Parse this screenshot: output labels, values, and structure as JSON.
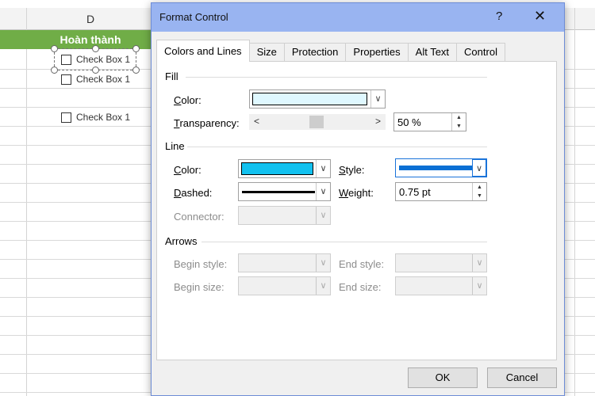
{
  "sheet": {
    "column_header": "D",
    "completed_header": "Hoàn thành",
    "checkboxes": [
      "Check Box 1",
      "Check Box 1",
      "Check Box 1"
    ]
  },
  "dialog": {
    "title": "Format Control",
    "help": "?",
    "close": "✕",
    "tabs": [
      "Colors and Lines",
      "Size",
      "Protection",
      "Properties",
      "Alt Text",
      "Control"
    ],
    "active_tab": "Colors and Lines",
    "fill": {
      "group": "Fill",
      "color_label": "Color:",
      "color_value": "#dff8ff",
      "transparency_label": "Transparency:",
      "transparency_value": "50 %",
      "transparency_percent": 50
    },
    "line": {
      "group": "Line",
      "color_label": "Color:",
      "color_value": "#12c1ef",
      "dashed_label": "Dashed:",
      "connector_label": "Connector:",
      "style_label": "Style:",
      "style_color": "#0a6fd4",
      "weight_label": "Weight:",
      "weight_value": "0.75 pt"
    },
    "arrows": {
      "group": "Arrows",
      "begin_style_label": "Begin style:",
      "begin_size_label": "Begin size:",
      "end_style_label": "End style:",
      "end_size_label": "End size:"
    },
    "ok": "OK",
    "cancel": "Cancel"
  },
  "colors": {
    "header_green": "#70ad47",
    "title_bar": "#99b4f1"
  },
  "icons": [
    "question-icon",
    "close-icon",
    "chevron-down-icon",
    "chevron-left-icon",
    "chevron-right-icon",
    "spin-up-icon",
    "spin-down-icon"
  ]
}
